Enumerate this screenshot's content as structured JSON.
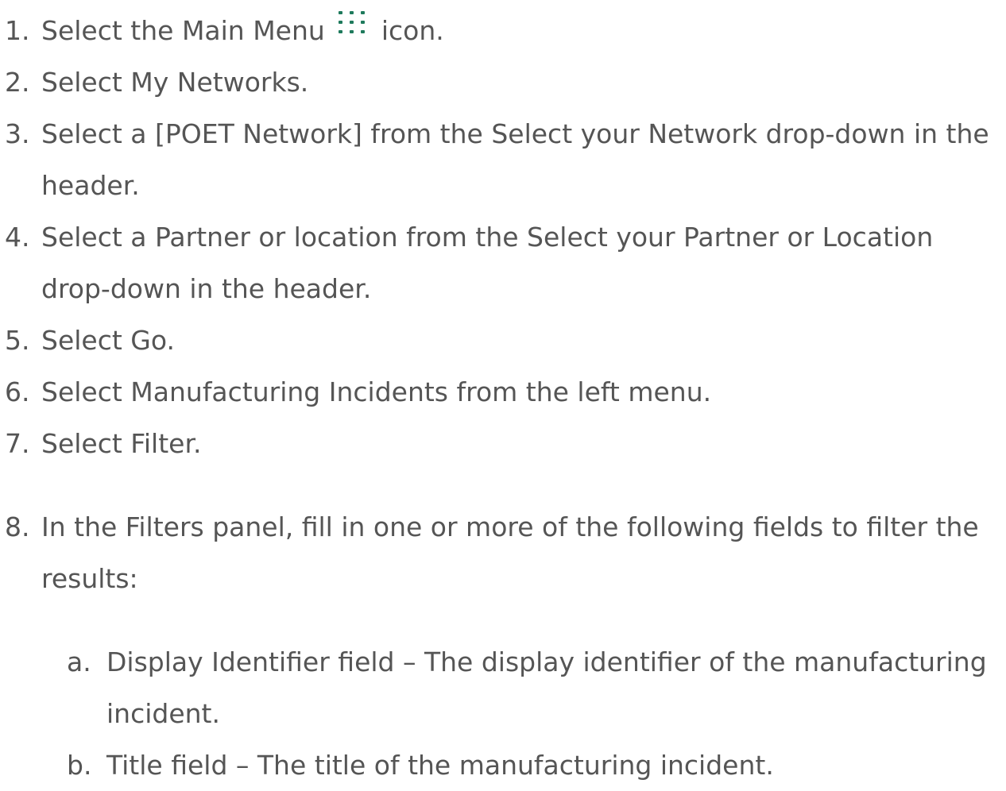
{
  "icon_color": "#1e7a5c",
  "steps": [
    {
      "n": "1.",
      "text_before": "Select the Main Menu",
      "icon": "grid-menu-icon",
      "text_after": "icon."
    },
    {
      "n": "2.",
      "text": "Select My Networks."
    },
    {
      "n": "3.",
      "text": "Select a [POET Network] from the Select your Network drop-down in the header."
    },
    {
      "n": "4.",
      "text": "Select a Partner or location from the Select your Partner or Location drop-down in the header."
    },
    {
      "n": "5.",
      "text": "Select Go."
    },
    {
      "n": "6.",
      "text": "Select Manufacturing Incidents from the left menu."
    },
    {
      "n": "7.",
      "text": "Select Filter."
    },
    {
      "n": "8.",
      "text": "In the Filters panel, fill in one or more of the following fields to filter the results:"
    }
  ],
  "substeps": [
    {
      "n": "a.",
      "text": "Display Identifier field – The display identifier of the manufacturing incident."
    },
    {
      "n": "b.",
      "text": "Title field – The title of the manufacturing incident."
    }
  ]
}
